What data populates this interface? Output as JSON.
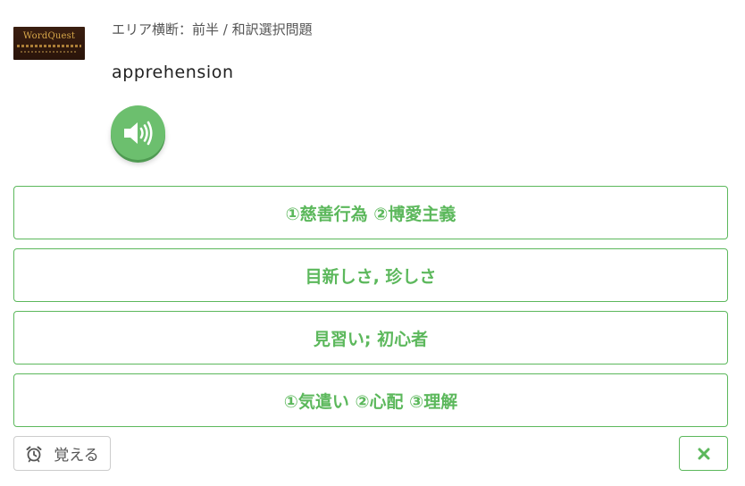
{
  "logo": {
    "text": "WordQuest"
  },
  "header": {
    "breadcrumb": "エリア横断：前半 / 和訳選択問題"
  },
  "question": {
    "word": "apprehension",
    "audio_icon": "speaker-volume-icon"
  },
  "choices": [
    {
      "label": "①慈善行為 ②博愛主義"
    },
    {
      "label": "目新しさ, 珍しさ"
    },
    {
      "label": "見習い; 初心者"
    },
    {
      "label": "①気遣い ②心配 ③理解"
    }
  ],
  "footer": {
    "remember_label": "覚える",
    "remember_icon": "alarm-clock-icon",
    "close_icon": "close-icon"
  },
  "colors": {
    "accent_green": "#5cb85c",
    "audio_green": "#6cbf6e",
    "logo_brown": "#2a140a",
    "logo_gold": "#d9a84a"
  }
}
